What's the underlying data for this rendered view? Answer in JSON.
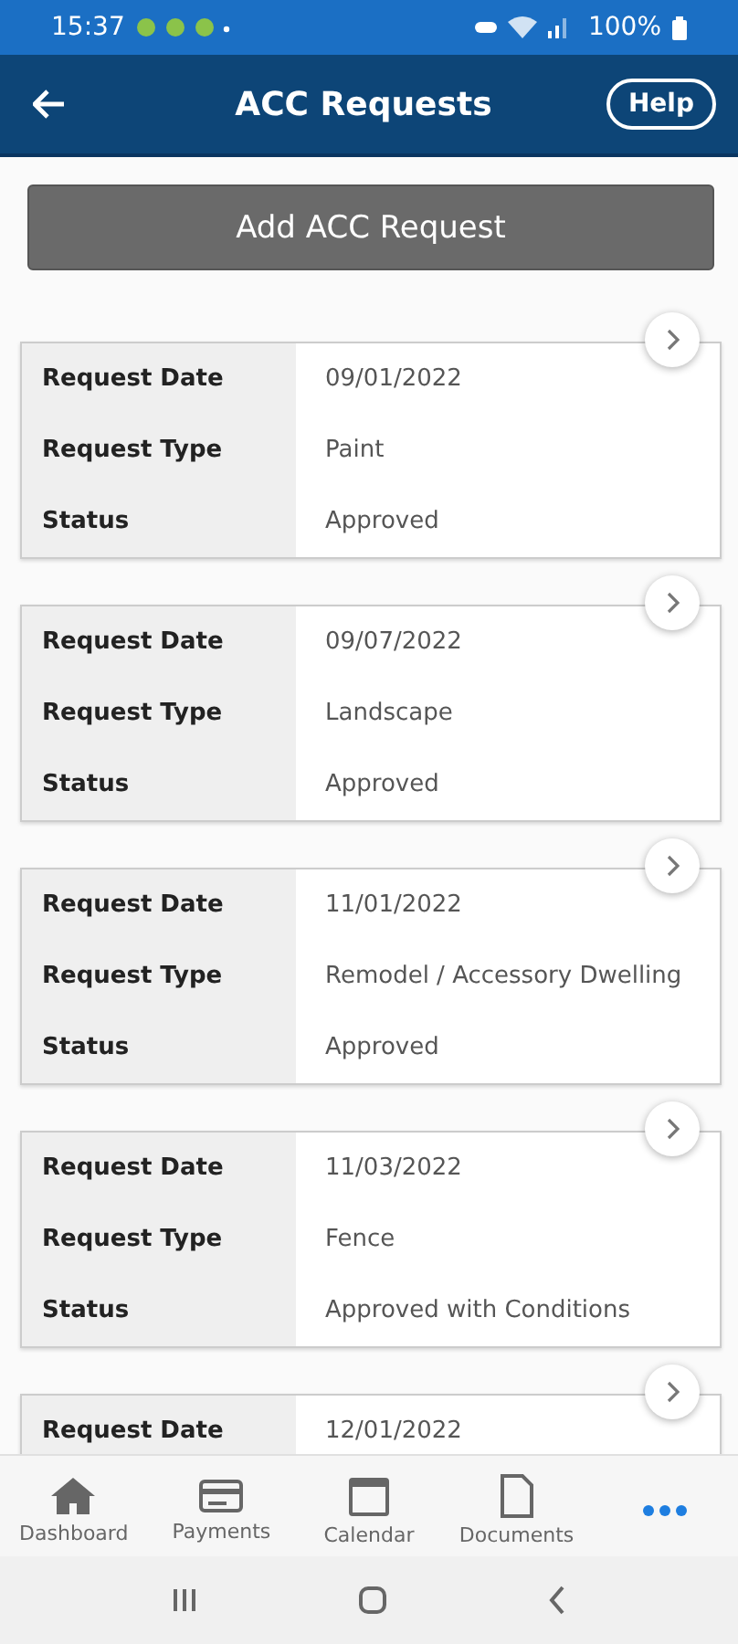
{
  "status_bar": {
    "time": "15:37",
    "battery": "100%"
  },
  "header": {
    "title": "ACC Requests",
    "help": "Help"
  },
  "add_button": "Add ACC Request",
  "requests": [
    {
      "rows": [
        {
          "label": "Request Date",
          "value": "09/01/2022"
        },
        {
          "label": "Request Type",
          "value": "Paint"
        },
        {
          "label": "Status",
          "value": "Approved"
        }
      ]
    },
    {
      "rows": [
        {
          "label": "Request Date",
          "value": "09/07/2022"
        },
        {
          "label": "Request Type",
          "value": "Landscape"
        },
        {
          "label": "Status",
          "value": "Approved"
        }
      ]
    },
    {
      "rows": [
        {
          "label": "Request Date",
          "value": "11/01/2022"
        },
        {
          "label": "Request Type",
          "value": "Remodel / Accessory Dwelling"
        },
        {
          "label": "Status",
          "value": "Approved"
        }
      ]
    },
    {
      "rows": [
        {
          "label": "Request Date",
          "value": "11/03/2022"
        },
        {
          "label": "Request Type",
          "value": "Fence"
        },
        {
          "label": "Status",
          "value": "Approved with Conditions"
        }
      ]
    },
    {
      "rows": [
        {
          "label": "Request Date",
          "value": "12/01/2022"
        }
      ]
    }
  ],
  "tabs": [
    {
      "kind": "home",
      "label": "Dashboard",
      "selected": false
    },
    {
      "kind": "card",
      "label": "Payments",
      "selected": false
    },
    {
      "kind": "calendar",
      "label": "Calendar",
      "selected": false
    },
    {
      "kind": "document",
      "label": "Documents",
      "selected": false
    },
    {
      "kind": "more",
      "selected": true
    }
  ]
}
